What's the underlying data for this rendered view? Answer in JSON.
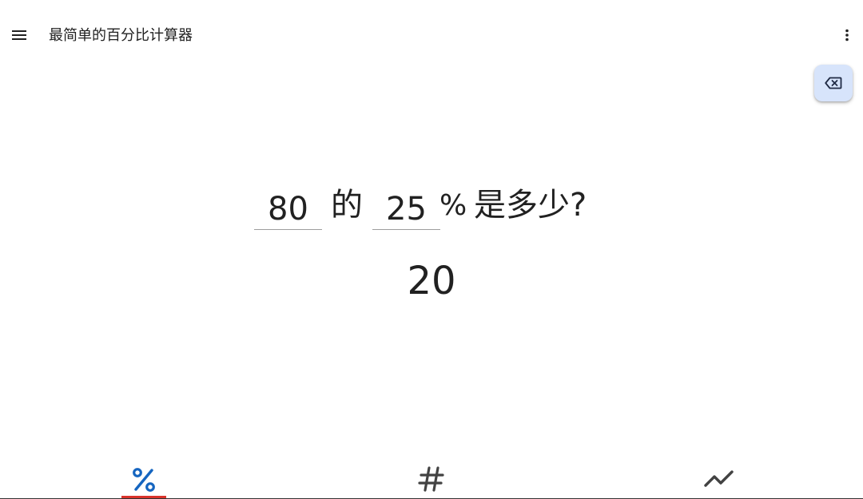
{
  "appbar": {
    "title": "最简单的百分比计算器",
    "menu_icon": "hamburger-menu-icon",
    "overflow_icon": "more-vertical-icon"
  },
  "fab": {
    "icon": "backspace-icon",
    "color": "#d7e4fb"
  },
  "question": {
    "value_a": "80",
    "word_of": "的",
    "value_b": "25",
    "percent_sign": "%",
    "question_text": "是多少?"
  },
  "result": {
    "value": "20"
  },
  "tabs": [
    {
      "id": "percent",
      "icon": "percent-icon",
      "glyph": "%",
      "color": "#1565c0",
      "selected": true
    },
    {
      "id": "number",
      "icon": "hash-icon",
      "glyph": "#",
      "color": "#424242",
      "selected": false
    },
    {
      "id": "trend",
      "icon": "trending-icon",
      "color": "#424242",
      "selected": false
    }
  ],
  "colors": {
    "tab_indicator": "#d9322a",
    "text_primary": "#212121"
  }
}
